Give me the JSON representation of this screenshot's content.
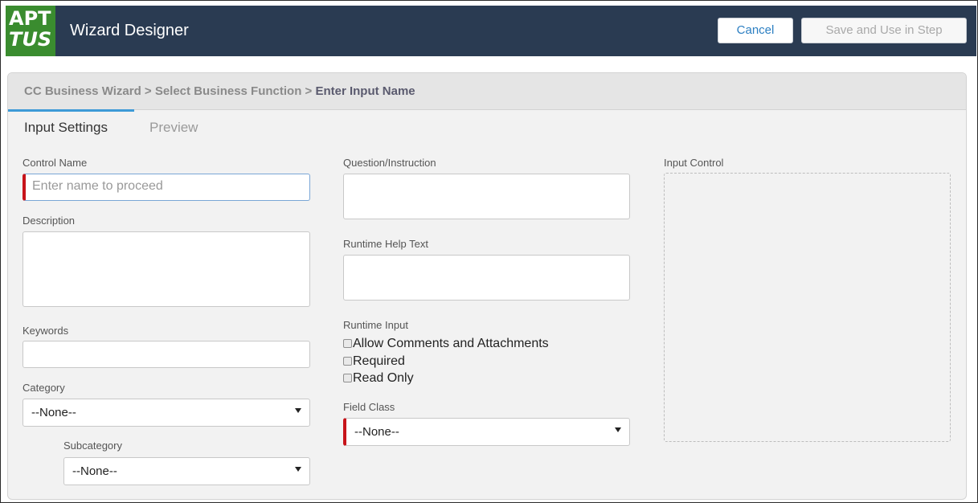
{
  "header": {
    "logo_top": "APT",
    "logo_bottom": "TUS",
    "title": "Wizard Designer",
    "cancel_label": "Cancel",
    "save_label": "Save and Use in Step"
  },
  "breadcrumb": {
    "part1": "CC Business Wizard > Select Business Function > ",
    "current": "Enter Input Name"
  },
  "tabs": {
    "input_settings": "Input Settings",
    "preview": "Preview"
  },
  "form": {
    "control_name": {
      "label": "Control Name",
      "placeholder": "Enter name to proceed"
    },
    "description_label": "Description",
    "keywords_label": "Keywords",
    "category": {
      "label": "Category",
      "value": "--None--"
    },
    "subcategory": {
      "label": "Subcategory",
      "value": "--None--"
    },
    "question_label": "Question/Instruction",
    "help_text_label": "Runtime Help Text",
    "runtime_input": {
      "label": "Runtime Input",
      "options": [
        "Allow Comments and Attachments",
        "Required",
        "Read Only"
      ]
    },
    "field_class": {
      "label": "Field Class",
      "value": "--None--"
    },
    "input_control_label": "Input Control"
  },
  "colors": {
    "header_bg": "#2a3b52",
    "logo_bg": "#3a8c2f",
    "accent": "#3d9ad7",
    "required_marker": "#c7141a"
  }
}
